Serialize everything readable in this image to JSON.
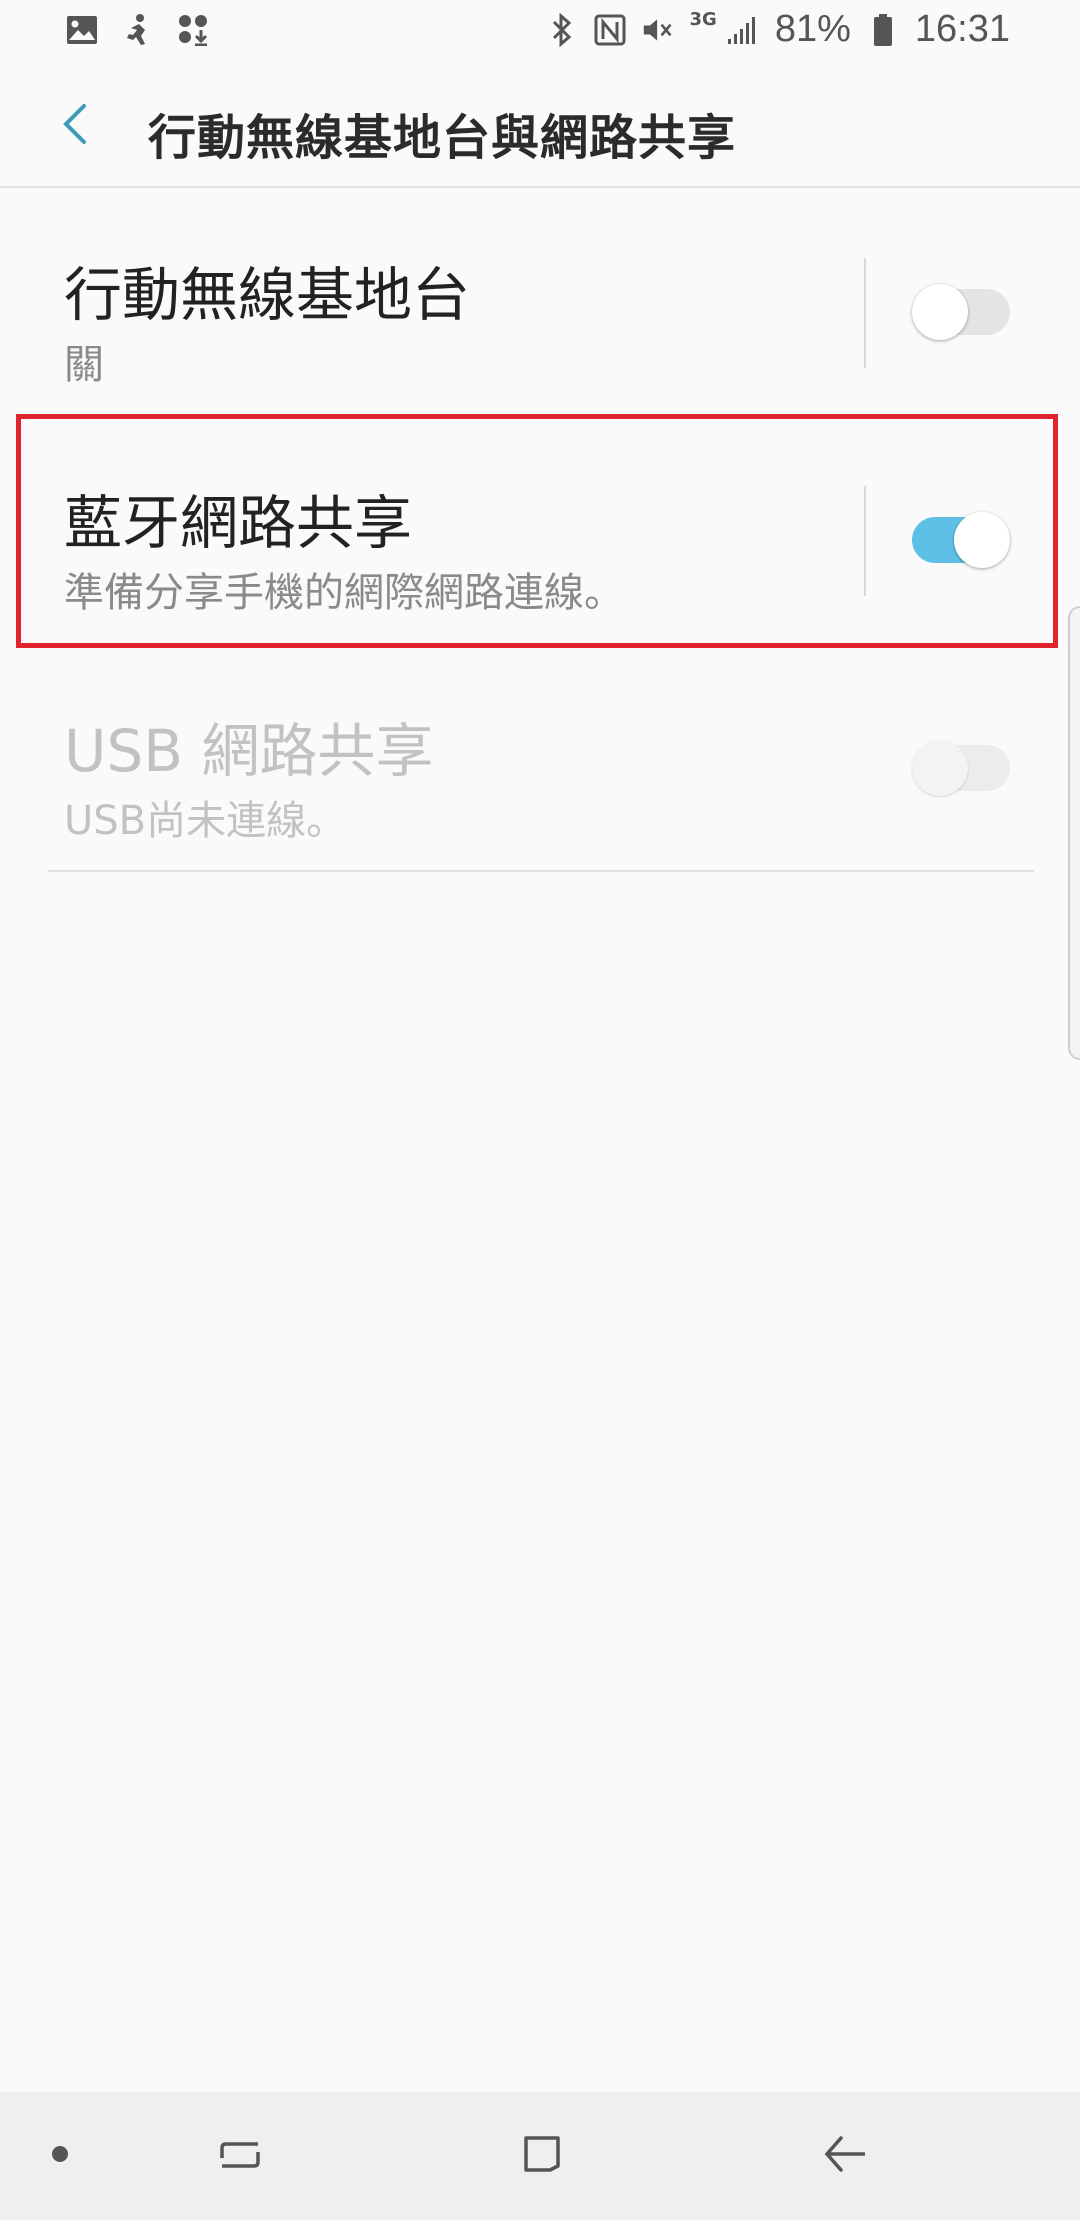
{
  "status_bar": {
    "icons_left": [
      "image-icon",
      "sport-activity-icon",
      "download-apps-icon"
    ],
    "icons_right": [
      "bluetooth-icon",
      "nfc-icon",
      "mute-icon"
    ],
    "network_type": "3G",
    "battery_percent": "81%",
    "time": "16:31"
  },
  "app_bar": {
    "title": "行動無線基地台與網路共享",
    "back_icon": "chevron-left-icon"
  },
  "items": [
    {
      "title": "行動無線基地台",
      "subtitle": "關",
      "toggle_on": false,
      "enabled": true
    },
    {
      "title": "藍牙網路共享",
      "subtitle": "準備分享手機的網際網路連線。",
      "toggle_on": true,
      "enabled": true
    },
    {
      "title": "USB 網路共享",
      "subtitle": "USB尚未連線。",
      "toggle_on": false,
      "enabled": false
    }
  ],
  "colors": {
    "accent": "#5ec0e6",
    "back_arrow": "#3d9bb5",
    "highlight": "#e0232c",
    "background": "#fafafa"
  },
  "nav_bar": {
    "buttons": [
      "dot-icon",
      "recent-apps-icon",
      "home-icon",
      "back-icon"
    ]
  }
}
